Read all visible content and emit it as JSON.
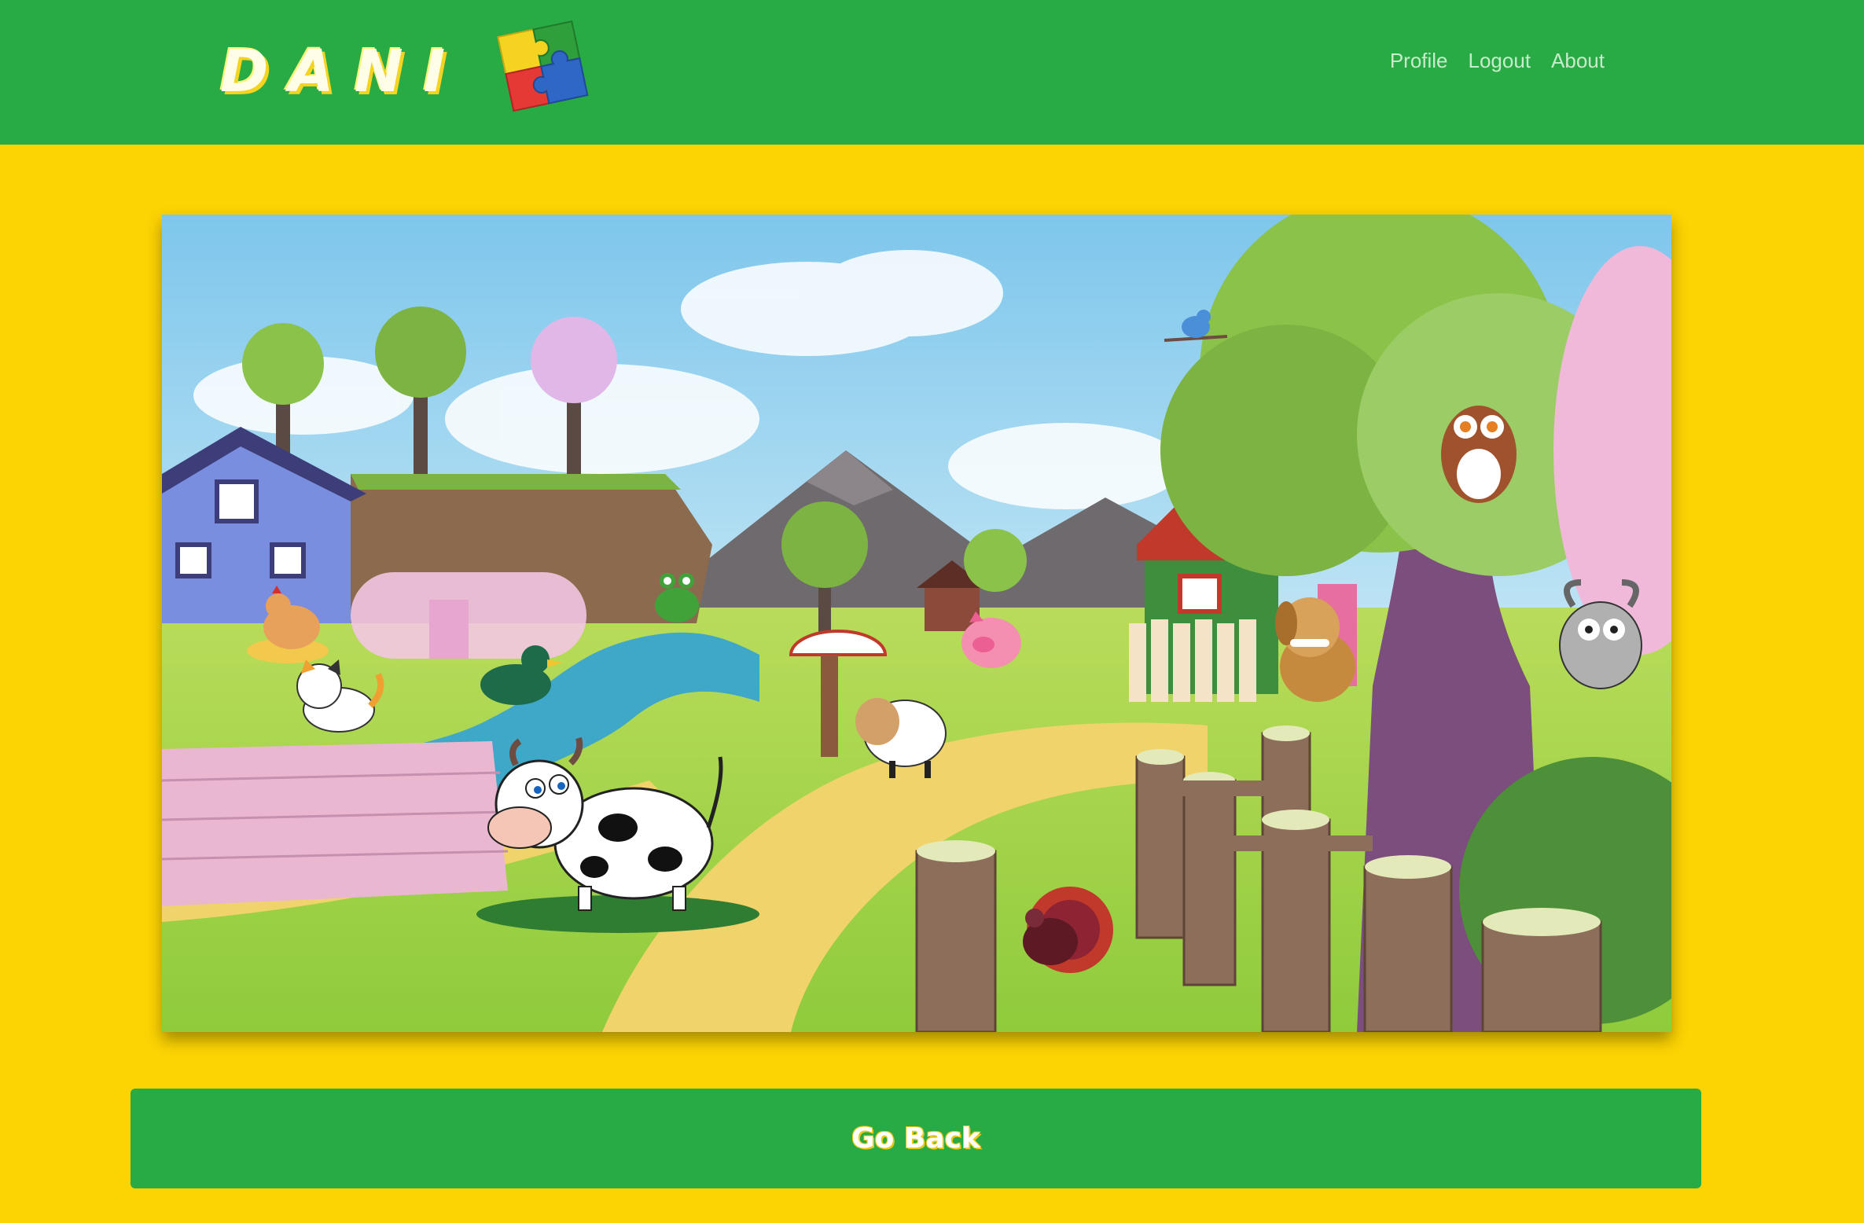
{
  "brand": {
    "name": "DANI",
    "logo_icon": "puzzle-pieces-icon"
  },
  "nav": {
    "items": [
      {
        "label": "Profile"
      },
      {
        "label": "Logout"
      },
      {
        "label": "About"
      }
    ]
  },
  "scene": {
    "name": "farm-scene",
    "animals": [
      "hen",
      "cat",
      "duck",
      "frog",
      "cow",
      "sheep",
      "pig",
      "turkey",
      "bird",
      "owl",
      "dog",
      "goat"
    ]
  },
  "actions": {
    "go_back_label": "Go Back"
  },
  "colors": {
    "navbar": "#28AA44",
    "background": "#FCD303",
    "button": "#28AA44"
  }
}
